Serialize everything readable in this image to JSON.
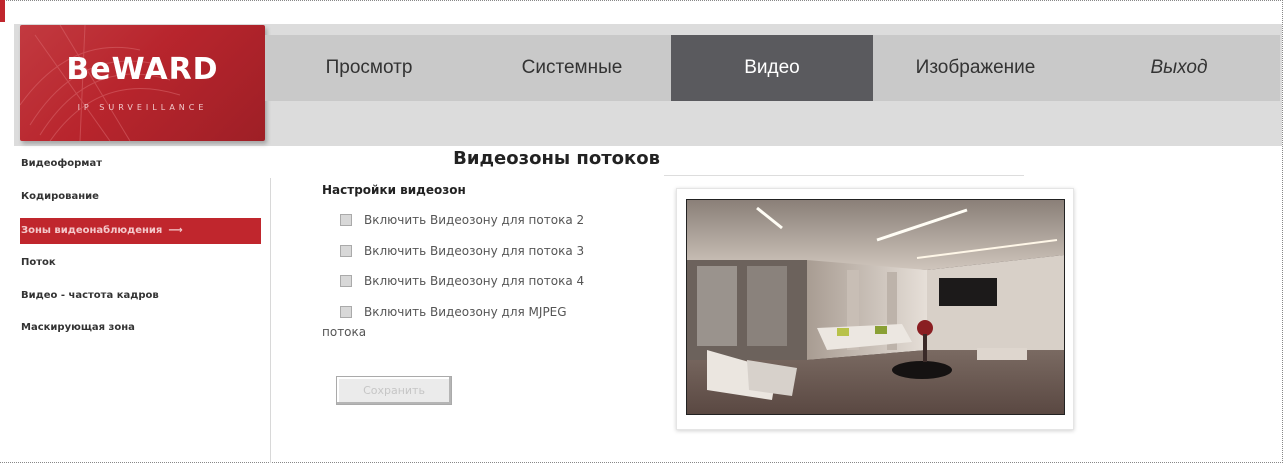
{
  "brand": {
    "logo_text": "BeWARD",
    "logo_subtext": "IP SURVEILLANCE"
  },
  "nav": {
    "tabs": [
      {
        "label": "Просмотр"
      },
      {
        "label": "Системные"
      },
      {
        "label": "Видео",
        "active": true
      },
      {
        "label": "Изображение"
      },
      {
        "label": "Выход"
      }
    ]
  },
  "sidebar": {
    "items": [
      {
        "label": "Видеоформат"
      },
      {
        "label": "Кодирование"
      },
      {
        "label": "Зоны видеонаблюдения",
        "active": true
      },
      {
        "label": "Поток"
      },
      {
        "label": "Видео - частота кадров"
      },
      {
        "label": "Маскирующая зона"
      }
    ]
  },
  "main": {
    "title": "Видеозоны потоков",
    "section_label": "Настройки видеозон",
    "options": [
      {
        "label": "Включить Видеозону для потока 2",
        "checked": false
      },
      {
        "label": "Включить Видеозону для потока 3",
        "checked": false
      },
      {
        "label": "Включить Видеозону для потока 4",
        "checked": false
      },
      {
        "label": "Включить Видеозону для MJPEG",
        "checked": false
      }
    ],
    "option_continuation": "потока",
    "save_label": "Сохранить"
  },
  "colors": {
    "brand_red": "#c0262d",
    "active_tab": "#5a5a5e",
    "nav_bg": "#c9c9c9"
  },
  "icons": {
    "arrow": "right-arrow-icon"
  }
}
